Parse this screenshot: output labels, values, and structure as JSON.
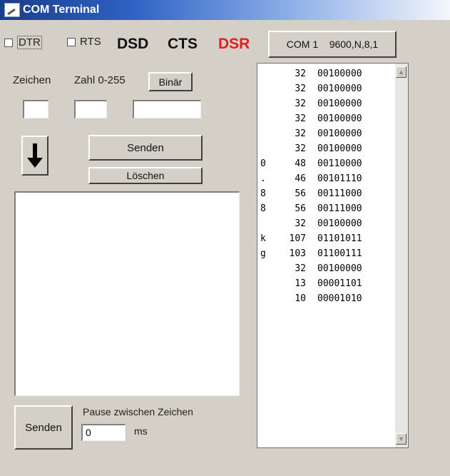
{
  "window": {
    "title": "COM Terminal",
    "icon": "terminal-icon"
  },
  "controls": {
    "dtr_label": "DTR",
    "rts_label": "RTS",
    "status_dsd": "DSD",
    "status_cts": "CTS",
    "status_dsr": "DSR",
    "status_dsr_color": "#e02020",
    "com_button": "COM 1    9600,N,8,1"
  },
  "input": {
    "zeichen_label": "Zeichen",
    "zahl_label": "Zahl 0-255",
    "binar_button": "Binär",
    "zeichen_value": "",
    "zahl_value": "",
    "binar_value": "",
    "arrow_icon": "down-arrow-icon",
    "arrow_symbol": "🡇",
    "senden_button": "Senden",
    "loschen_button": "Löschen"
  },
  "bottom": {
    "senden_button": "Senden",
    "pause_label": "Pause zwischen Zeichen",
    "pause_value": "0",
    "ms_label": "ms"
  },
  "received": [
    {
      "char": "",
      "dec": "32",
      "bin": "00100000"
    },
    {
      "char": "",
      "dec": "32",
      "bin": "00100000"
    },
    {
      "char": "",
      "dec": "32",
      "bin": "00100000"
    },
    {
      "char": "",
      "dec": "32",
      "bin": "00100000"
    },
    {
      "char": "",
      "dec": "32",
      "bin": "00100000"
    },
    {
      "char": "",
      "dec": "32",
      "bin": "00100000"
    },
    {
      "char": "0",
      "dec": "48",
      "bin": "00110000"
    },
    {
      "char": ".",
      "dec": "46",
      "bin": "00101110"
    },
    {
      "char": "8",
      "dec": "56",
      "bin": "00111000"
    },
    {
      "char": "8",
      "dec": "56",
      "bin": "00111000"
    },
    {
      "char": "",
      "dec": "32",
      "bin": "00100000"
    },
    {
      "char": "k",
      "dec": "107",
      "bin": "01101011"
    },
    {
      "char": "g",
      "dec": "103",
      "bin": "01100111"
    },
    {
      "char": "",
      "dec": "32",
      "bin": "00100000"
    },
    {
      "char": "",
      "dec": "13",
      "bin": "00001101"
    },
    {
      "char": "",
      "dec": "10",
      "bin": "00001010"
    }
  ]
}
